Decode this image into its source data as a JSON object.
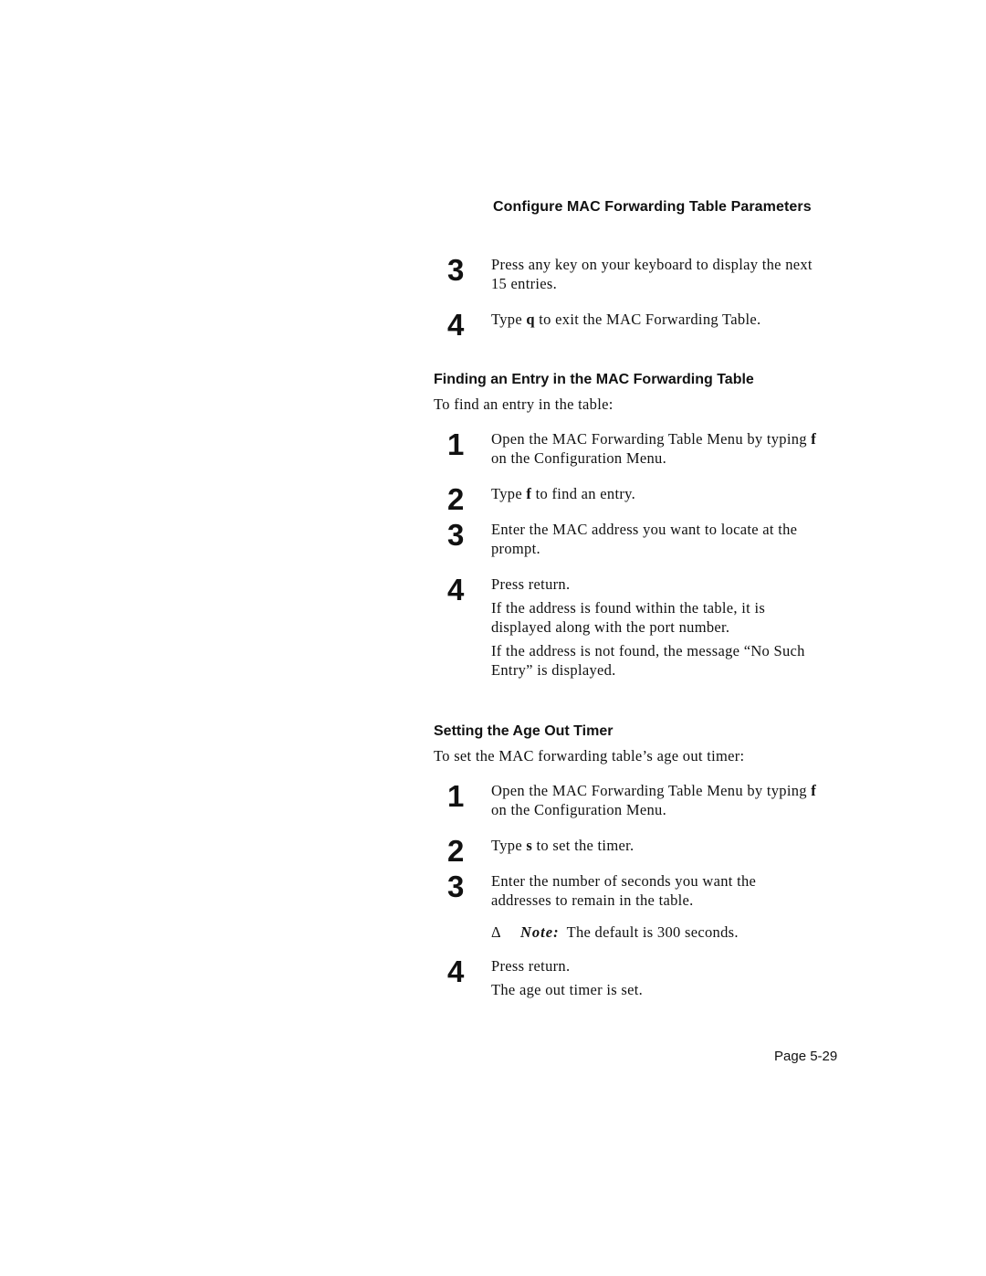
{
  "running_head": "Configure MAC Forwarding Table Parameters",
  "continued_steps": [
    {
      "num": "3",
      "paragraphs": [
        [
          "Press any key on your keyboard to display the next 15 entries."
        ]
      ]
    },
    {
      "num": "4",
      "paragraphs": [
        [
          "Type ",
          {
            "b": "q"
          },
          " to exit the MAC Forwarding Table."
        ]
      ]
    }
  ],
  "find_section": {
    "title": "Finding an Entry in the MAC Forwarding Table",
    "intro": "To find an entry in the table:",
    "steps": [
      {
        "num": "1",
        "paragraphs": [
          [
            "Open the MAC Forwarding Table Menu by typing ",
            {
              "b": "f"
            },
            " on the Configuration Menu."
          ]
        ]
      },
      {
        "num": "2",
        "paragraphs": [
          [
            "Type ",
            {
              "b": "f"
            },
            " to find an entry."
          ]
        ]
      },
      {
        "num": "3",
        "paragraphs": [
          [
            "Enter the MAC address you want to locate at the prompt."
          ]
        ]
      },
      {
        "num": "4",
        "paragraphs": [
          [
            "Press return."
          ],
          [
            "If the address is found within the table, it is displayed along with the port number."
          ],
          [
            "If the address is not found, the message “No Such Entry” is displayed."
          ]
        ]
      }
    ]
  },
  "age_section": {
    "title": "Setting the Age Out Timer",
    "intro": "To set the MAC forwarding table’s age out timer:",
    "steps": [
      {
        "num": "1",
        "paragraphs": [
          [
            "Open the MAC Forwarding Table Menu by typing ",
            {
              "b": "f"
            },
            " on the Configuration Menu."
          ]
        ]
      },
      {
        "num": "2",
        "paragraphs": [
          [
            "Type ",
            {
              "b": "s"
            },
            " to set the timer."
          ]
        ]
      },
      {
        "num": "3",
        "paragraphs": [
          [
            "Enter the number of seconds you want the addresses to remain in the table."
          ]
        ]
      },
      {
        "num": "4",
        "paragraphs": [
          [
            "Press return."
          ],
          [
            "The age out timer is set."
          ]
        ]
      }
    ],
    "note": {
      "symbol": "Δ",
      "label": "Note:",
      "text": "The default is 300 seconds."
    }
  },
  "page_number": "Page 5-29"
}
